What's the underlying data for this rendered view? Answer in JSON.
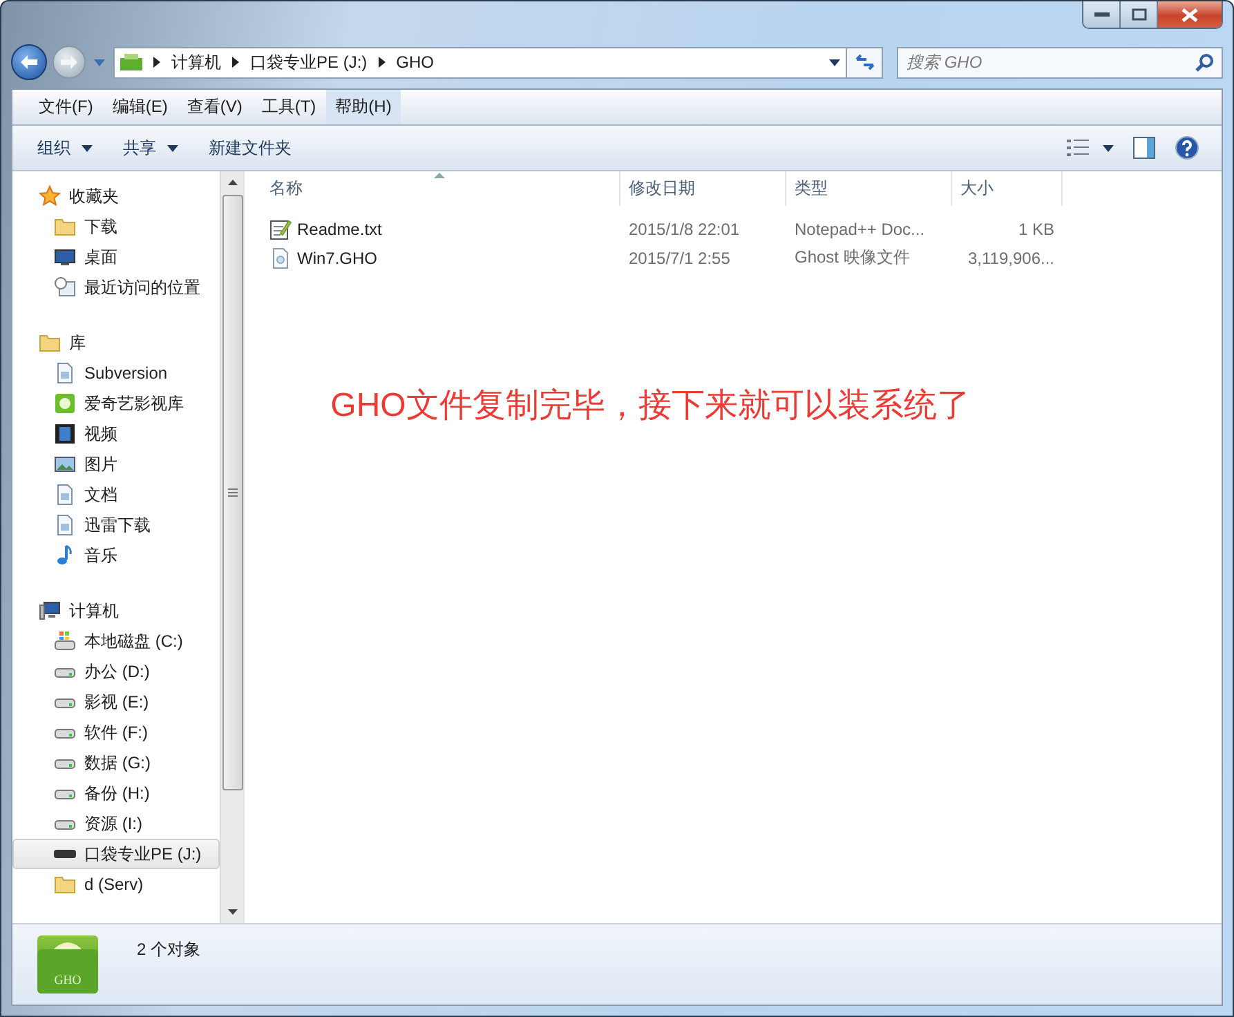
{
  "address": {
    "crumbs": [
      "计算机",
      "口袋专业PE (J:)",
      "GHO"
    ]
  },
  "search": {
    "placeholder": "搜索 GHO"
  },
  "menu": [
    {
      "label": "文件(F)",
      "highlighted": false
    },
    {
      "label": "编辑(E)",
      "highlighted": false
    },
    {
      "label": "查看(V)",
      "highlighted": false
    },
    {
      "label": "工具(T)",
      "highlighted": false
    },
    {
      "label": "帮助(H)",
      "highlighted": true
    }
  ],
  "commands": [
    {
      "label": "组织",
      "dropdown": true
    },
    {
      "label": "共享",
      "dropdown": true
    },
    {
      "label": "新建文件夹",
      "dropdown": false
    }
  ],
  "sidebar": {
    "groups": [
      {
        "label": "收藏夹",
        "kind": "favorites",
        "children": [
          {
            "label": "下载",
            "kind": "folder",
            "selected": false
          },
          {
            "label": "桌面",
            "kind": "desktop",
            "selected": false
          },
          {
            "label": "最近访问的位置",
            "kind": "recent",
            "selected": false
          }
        ]
      },
      {
        "label": "库",
        "kind": "library",
        "children": [
          {
            "label": "Subversion",
            "kind": "document",
            "selected": false
          },
          {
            "label": "爱奇艺影视库",
            "kind": "app",
            "selected": false
          },
          {
            "label": "视频",
            "kind": "video",
            "selected": false
          },
          {
            "label": "图片",
            "kind": "picture",
            "selected": false
          },
          {
            "label": "文档",
            "kind": "document",
            "selected": false
          },
          {
            "label": "迅雷下载",
            "kind": "document",
            "selected": false
          },
          {
            "label": "音乐",
            "kind": "music",
            "selected": false
          }
        ]
      },
      {
        "label": "计算机",
        "kind": "computer",
        "children": [
          {
            "label": "本地磁盘 (C:)",
            "kind": "system-drive",
            "selected": false
          },
          {
            "label": "办公 (D:)",
            "kind": "drive",
            "selected": false
          },
          {
            "label": "影视 (E:)",
            "kind": "drive",
            "selected": false
          },
          {
            "label": "软件 (F:)",
            "kind": "drive",
            "selected": false
          },
          {
            "label": "数据 (G:)",
            "kind": "drive",
            "selected": false
          },
          {
            "label": "备份 (H:)",
            "kind": "drive",
            "selected": false
          },
          {
            "label": "资源 (I:)",
            "kind": "drive",
            "selected": false
          },
          {
            "label": "口袋专业PE (J:)",
            "kind": "removable",
            "selected": true
          },
          {
            "label": "d (Serv)",
            "kind": "folder",
            "selected": false
          }
        ]
      }
    ]
  },
  "table": {
    "columns": [
      "名称",
      "修改日期",
      "类型",
      "大小"
    ],
    "rows": [
      {
        "name": "Readme.txt",
        "kind": "text",
        "date": "2015/1/8 22:01",
        "type": "Notepad++ Doc...",
        "size": "1 KB"
      },
      {
        "name": "Win7.GHO",
        "kind": "image",
        "date": "2015/7/1 2:55",
        "type": "Ghost 映像文件",
        "size": "3,119,906..."
      }
    ]
  },
  "annotation": "GHO文件复制完毕，接下来就可以装系统了",
  "status": {
    "icon_label": "GHO",
    "text": "2 个对象"
  }
}
